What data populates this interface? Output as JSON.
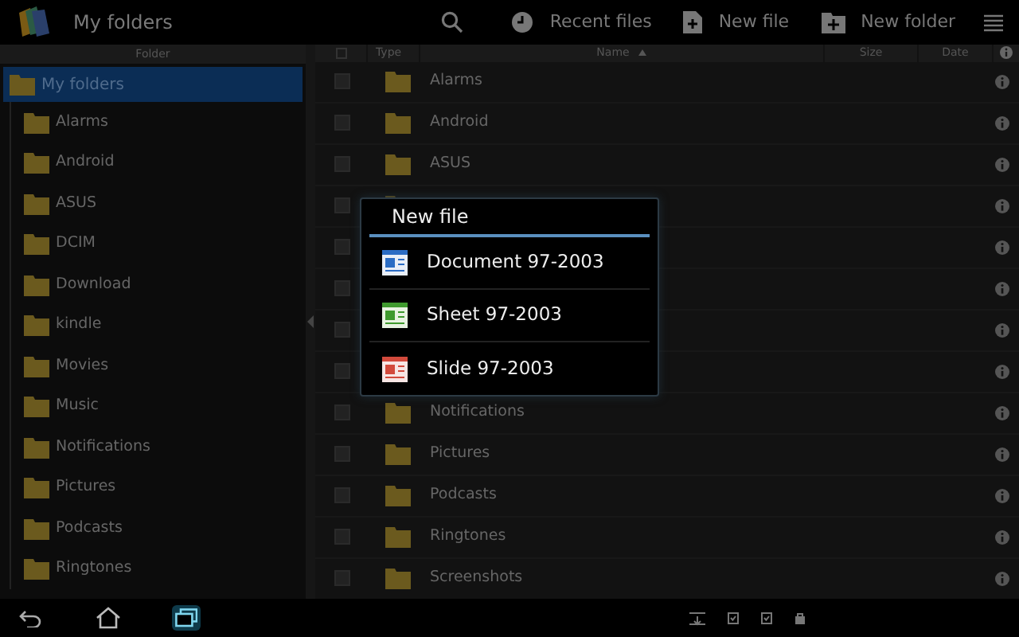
{
  "action_bar": {
    "title": "My folders",
    "actions": [
      {
        "kind": "search"
      },
      {
        "kind": "clock",
        "label": "Recent files"
      },
      {
        "kind": "file",
        "label": "New file"
      },
      {
        "kind": "folder",
        "label": "New folder"
      },
      {
        "kind": "menu"
      }
    ]
  },
  "folder_panel": {
    "header": "Folder",
    "root": {
      "label": "My folders",
      "selected": true,
      "children": [
        {
          "label": "Alarms"
        },
        {
          "label": "Android"
        },
        {
          "label": "ASUS"
        },
        {
          "label": "DCIM"
        },
        {
          "label": "Download"
        },
        {
          "label": "kindle"
        },
        {
          "label": "Movies"
        },
        {
          "label": "Music"
        },
        {
          "label": "Notifications"
        },
        {
          "label": "Pictures"
        },
        {
          "label": "Podcasts"
        },
        {
          "label": "Ringtones"
        }
      ]
    }
  },
  "file_list": {
    "columns": [
      {
        "kind": "check"
      },
      {
        "kind": "text",
        "label": "Type"
      },
      {
        "kind": "sort",
        "label": "Name"
      },
      {
        "kind": "text",
        "label": "Size"
      },
      {
        "kind": "text",
        "label": "Date"
      },
      {
        "kind": "info"
      }
    ],
    "rows": [
      {
        "name": "Alarms",
        "checked": false
      },
      {
        "name": "Android",
        "checked": false
      },
      {
        "name": "ASUS",
        "checked": false
      },
      {
        "checked": false
      },
      {
        "checked": false
      },
      {
        "checked": false
      },
      {
        "checked": false
      },
      {
        "checked": false
      },
      {
        "name": "Notifications",
        "checked": false
      },
      {
        "name": "Pictures",
        "checked": false
      },
      {
        "name": "Podcasts",
        "checked": false
      },
      {
        "name": "Ringtones",
        "checked": false
      },
      {
        "name": "Screenshots",
        "checked": false
      }
    ]
  },
  "dialog": {
    "title": "New file",
    "items": [
      {
        "kind": "doc",
        "label": "Document 97-2003"
      },
      {
        "kind": "sheet",
        "label": "Sheet 97-2003"
      },
      {
        "kind": "slide",
        "label": "Slide 97-2003"
      }
    ]
  },
  "nav_bar": {
    "buttons": [
      {
        "kind": "back",
        "selected": false
      },
      {
        "kind": "home",
        "selected": false
      },
      {
        "kind": "recent",
        "selected": true
      }
    ],
    "status_icons": [
      {
        "kind": "download"
      },
      {
        "kind": "task"
      },
      {
        "kind": "task"
      },
      {
        "kind": "lock"
      }
    ]
  }
}
